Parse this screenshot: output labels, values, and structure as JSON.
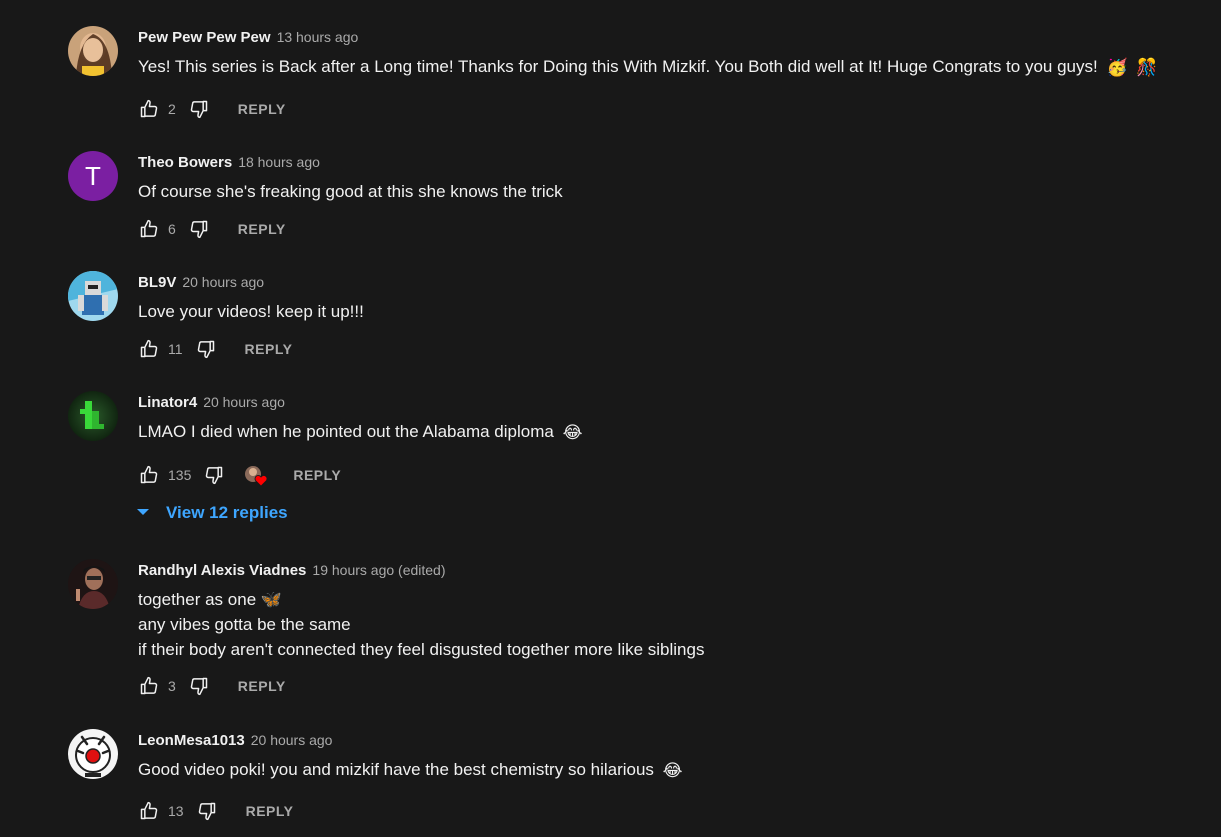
{
  "comments": [
    {
      "author": "Pew Pew Pew Pew",
      "time": "13 hours ago",
      "lines": [
        "Yes! This series is Back after a Long time! Thanks for Doing this With Mizkif. You Both did well at It! Huge Congrats to you guys!"
      ],
      "likes": "2",
      "reply": "REPLY",
      "emoji": [
        "🥳",
        "🎊"
      ]
    },
    {
      "author": "Theo Bowers",
      "time": "18 hours ago",
      "avatar_letter": "T",
      "lines": [
        "Of course she's freaking good at this she knows the trick"
      ],
      "likes": "6",
      "reply": "REPLY"
    },
    {
      "author": "BL9V",
      "time": "20 hours ago",
      "lines": [
        "Love your videos! keep it up!!!"
      ],
      "likes": "11",
      "reply": "REPLY"
    },
    {
      "author": "Linator4",
      "time": "20 hours ago",
      "lines": [
        "LMAO I died when he pointed out the Alabama diploma"
      ],
      "likes": "135",
      "reply": "REPLY",
      "emoji": [
        "😂"
      ],
      "view_replies": "View 12 replies"
    },
    {
      "author": "Randhyl Alexis Viadnes",
      "time": "19 hours ago (edited)",
      "lines": [
        "together as one 🦋",
        "any vibes gotta be the same",
        "if their body aren't connected they feel disgusted together more like siblings"
      ],
      "likes": "3",
      "reply": "REPLY"
    },
    {
      "author": "LeonMesa1013",
      "time": "20 hours ago",
      "lines": [
        "Good video poki! you and mizkif have the best chemistry so hilarious"
      ],
      "likes": "13",
      "reply": "REPLY",
      "emoji": [
        "😂"
      ]
    }
  ],
  "colors": {
    "background": "#181818",
    "text": "#f1f1f1",
    "secondary": "#aaaaaa",
    "link": "#3ea6ff",
    "letter_avatar": "#7b1fa2"
  },
  "icons": {
    "like": "thumbs-up-icon",
    "dislike": "thumbs-down-icon",
    "hearted": "creator-heart-icon",
    "expand": "caret-down-icon"
  }
}
